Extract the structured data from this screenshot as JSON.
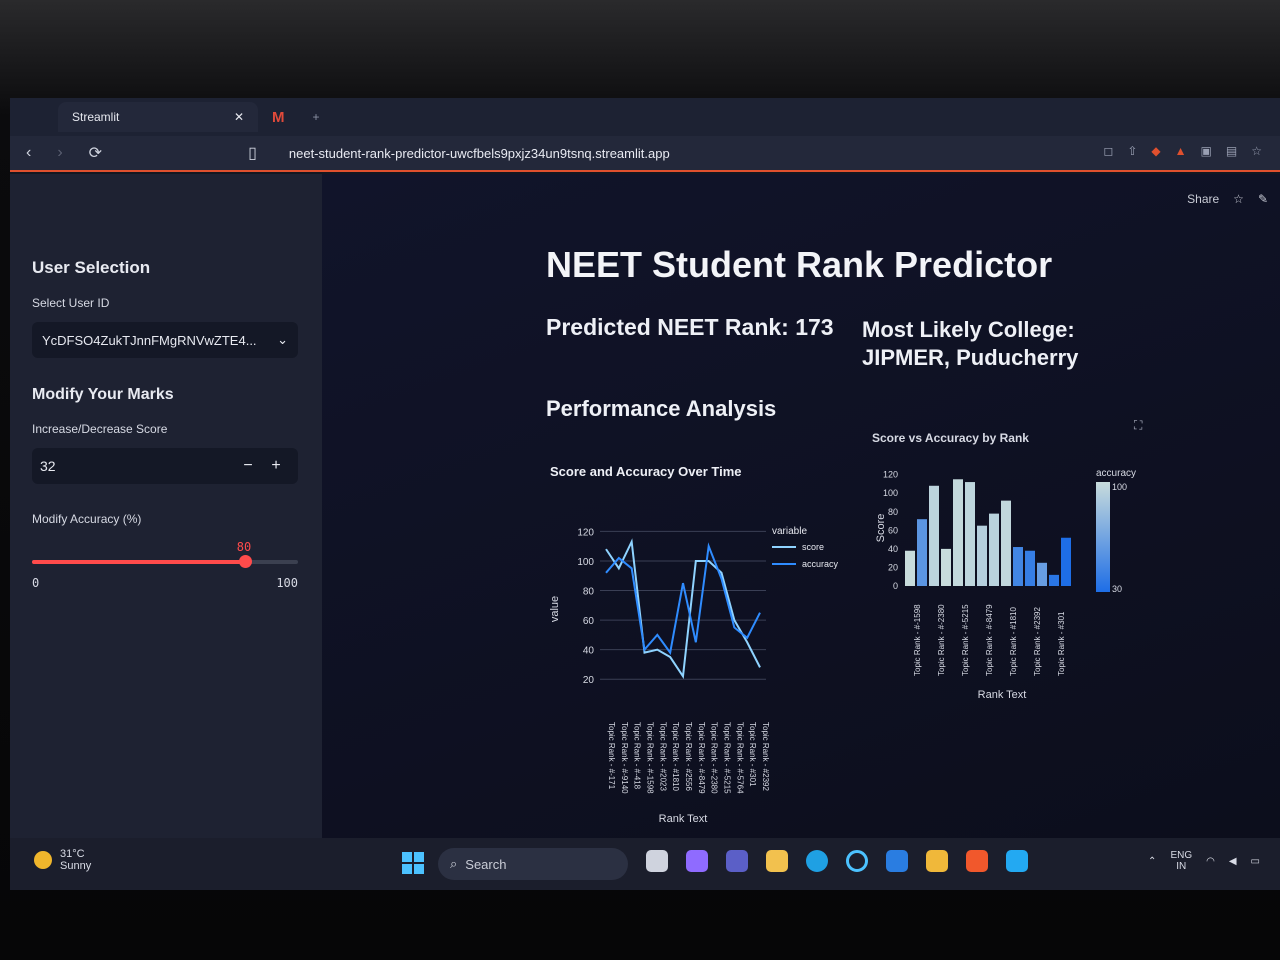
{
  "browser": {
    "tabs": [
      {
        "label": "Streamlit",
        "active": true
      },
      {
        "label": "",
        "icon": "gmail-icon"
      }
    ],
    "url": "neet-student-rank-predictor-uwcfbels9pxjz34un9tsnq.streamlit.app"
  },
  "toolbar": {
    "share": "Share"
  },
  "sidebar": {
    "heading": "User Selection",
    "select_label": "Select User ID",
    "select_value": "YcDFSO4ZukTJnnFMgRNVwZTE4...",
    "modify_heading": "Modify Your Marks",
    "score_label": "Increase/Decrease Score",
    "score_value": "32",
    "accuracy_label": "Modify Accuracy (%)",
    "accuracy_value": "80",
    "accuracy_min": "0",
    "accuracy_max": "100",
    "accuracy_level": 0.8
  },
  "main": {
    "title": "NEET Student Rank Predictor",
    "predicted_rank": "Predicted NEET Rank: 173",
    "college": "Most Likely College: JIPMER, Puducherry",
    "performance": "Performance Analysis"
  },
  "chart_data": [
    {
      "type": "line",
      "title": "Score and Accuracy Over Time",
      "xlabel": "Rank Text",
      "ylabel": "value",
      "legend_title": "variable",
      "legend_position": "top-right",
      "categories": [
        "Topic Rank - #-171",
        "Topic Rank - #-9140",
        "Topic Rank - #-418",
        "Topic Rank - #-1598",
        "Topic Rank - #2023",
        "Topic Rank - #1810",
        "Topic Rank - #2556",
        "Topic Rank - #-8479",
        "Topic Rank - #-2380",
        "Topic Rank - #-5215",
        "Topic Rank - #-5764",
        "Topic Rank - #301",
        "Topic Rank - #2392"
      ],
      "yticks": [
        20,
        40,
        60,
        80,
        100,
        120
      ],
      "ylim": [
        10,
        125
      ],
      "series": [
        {
          "name": "score",
          "color": "#8fd3ff",
          "values": [
            108,
            95,
            113,
            38,
            40,
            35,
            22,
            100,
            100,
            92,
            60,
            45,
            28
          ]
        },
        {
          "name": "accuracy",
          "color": "#2f8cff",
          "values": [
            92,
            102,
            95,
            40,
            50,
            38,
            85,
            45,
            110,
            88,
            55,
            48,
            65
          ]
        }
      ]
    },
    {
      "type": "bar",
      "title": "Score vs Accuracy by Rank",
      "xlabel": "Rank Text",
      "ylabel": "Score",
      "colorbar_label": "accuracy",
      "colorbar_ticks": [
        "100",
        "30"
      ],
      "categories": [
        "Topic Rank - #-1598",
        "Topic Rank - #-2380",
        "Topic Rank - #-5215",
        "Topic Rank - #-8479",
        "Topic Rank - #1810",
        "Topic Rank - #2392",
        "Topic Rank - #301"
      ],
      "yticks": [
        0,
        20,
        40,
        60,
        80,
        100,
        120
      ],
      "ylim": [
        0,
        125
      ],
      "values": [
        38,
        72,
        108,
        40,
        115,
        112,
        65,
        78,
        92,
        42,
        38,
        25,
        12,
        52
      ],
      "accuracy": [
        100,
        55,
        95,
        100,
        98,
        96,
        92,
        94,
        97,
        45,
        40,
        60,
        35,
        30
      ]
    }
  ],
  "taskbar": {
    "temp": "31°C",
    "weather": "Sunny",
    "search": "Search",
    "lang": "ENG",
    "region": "IN"
  }
}
